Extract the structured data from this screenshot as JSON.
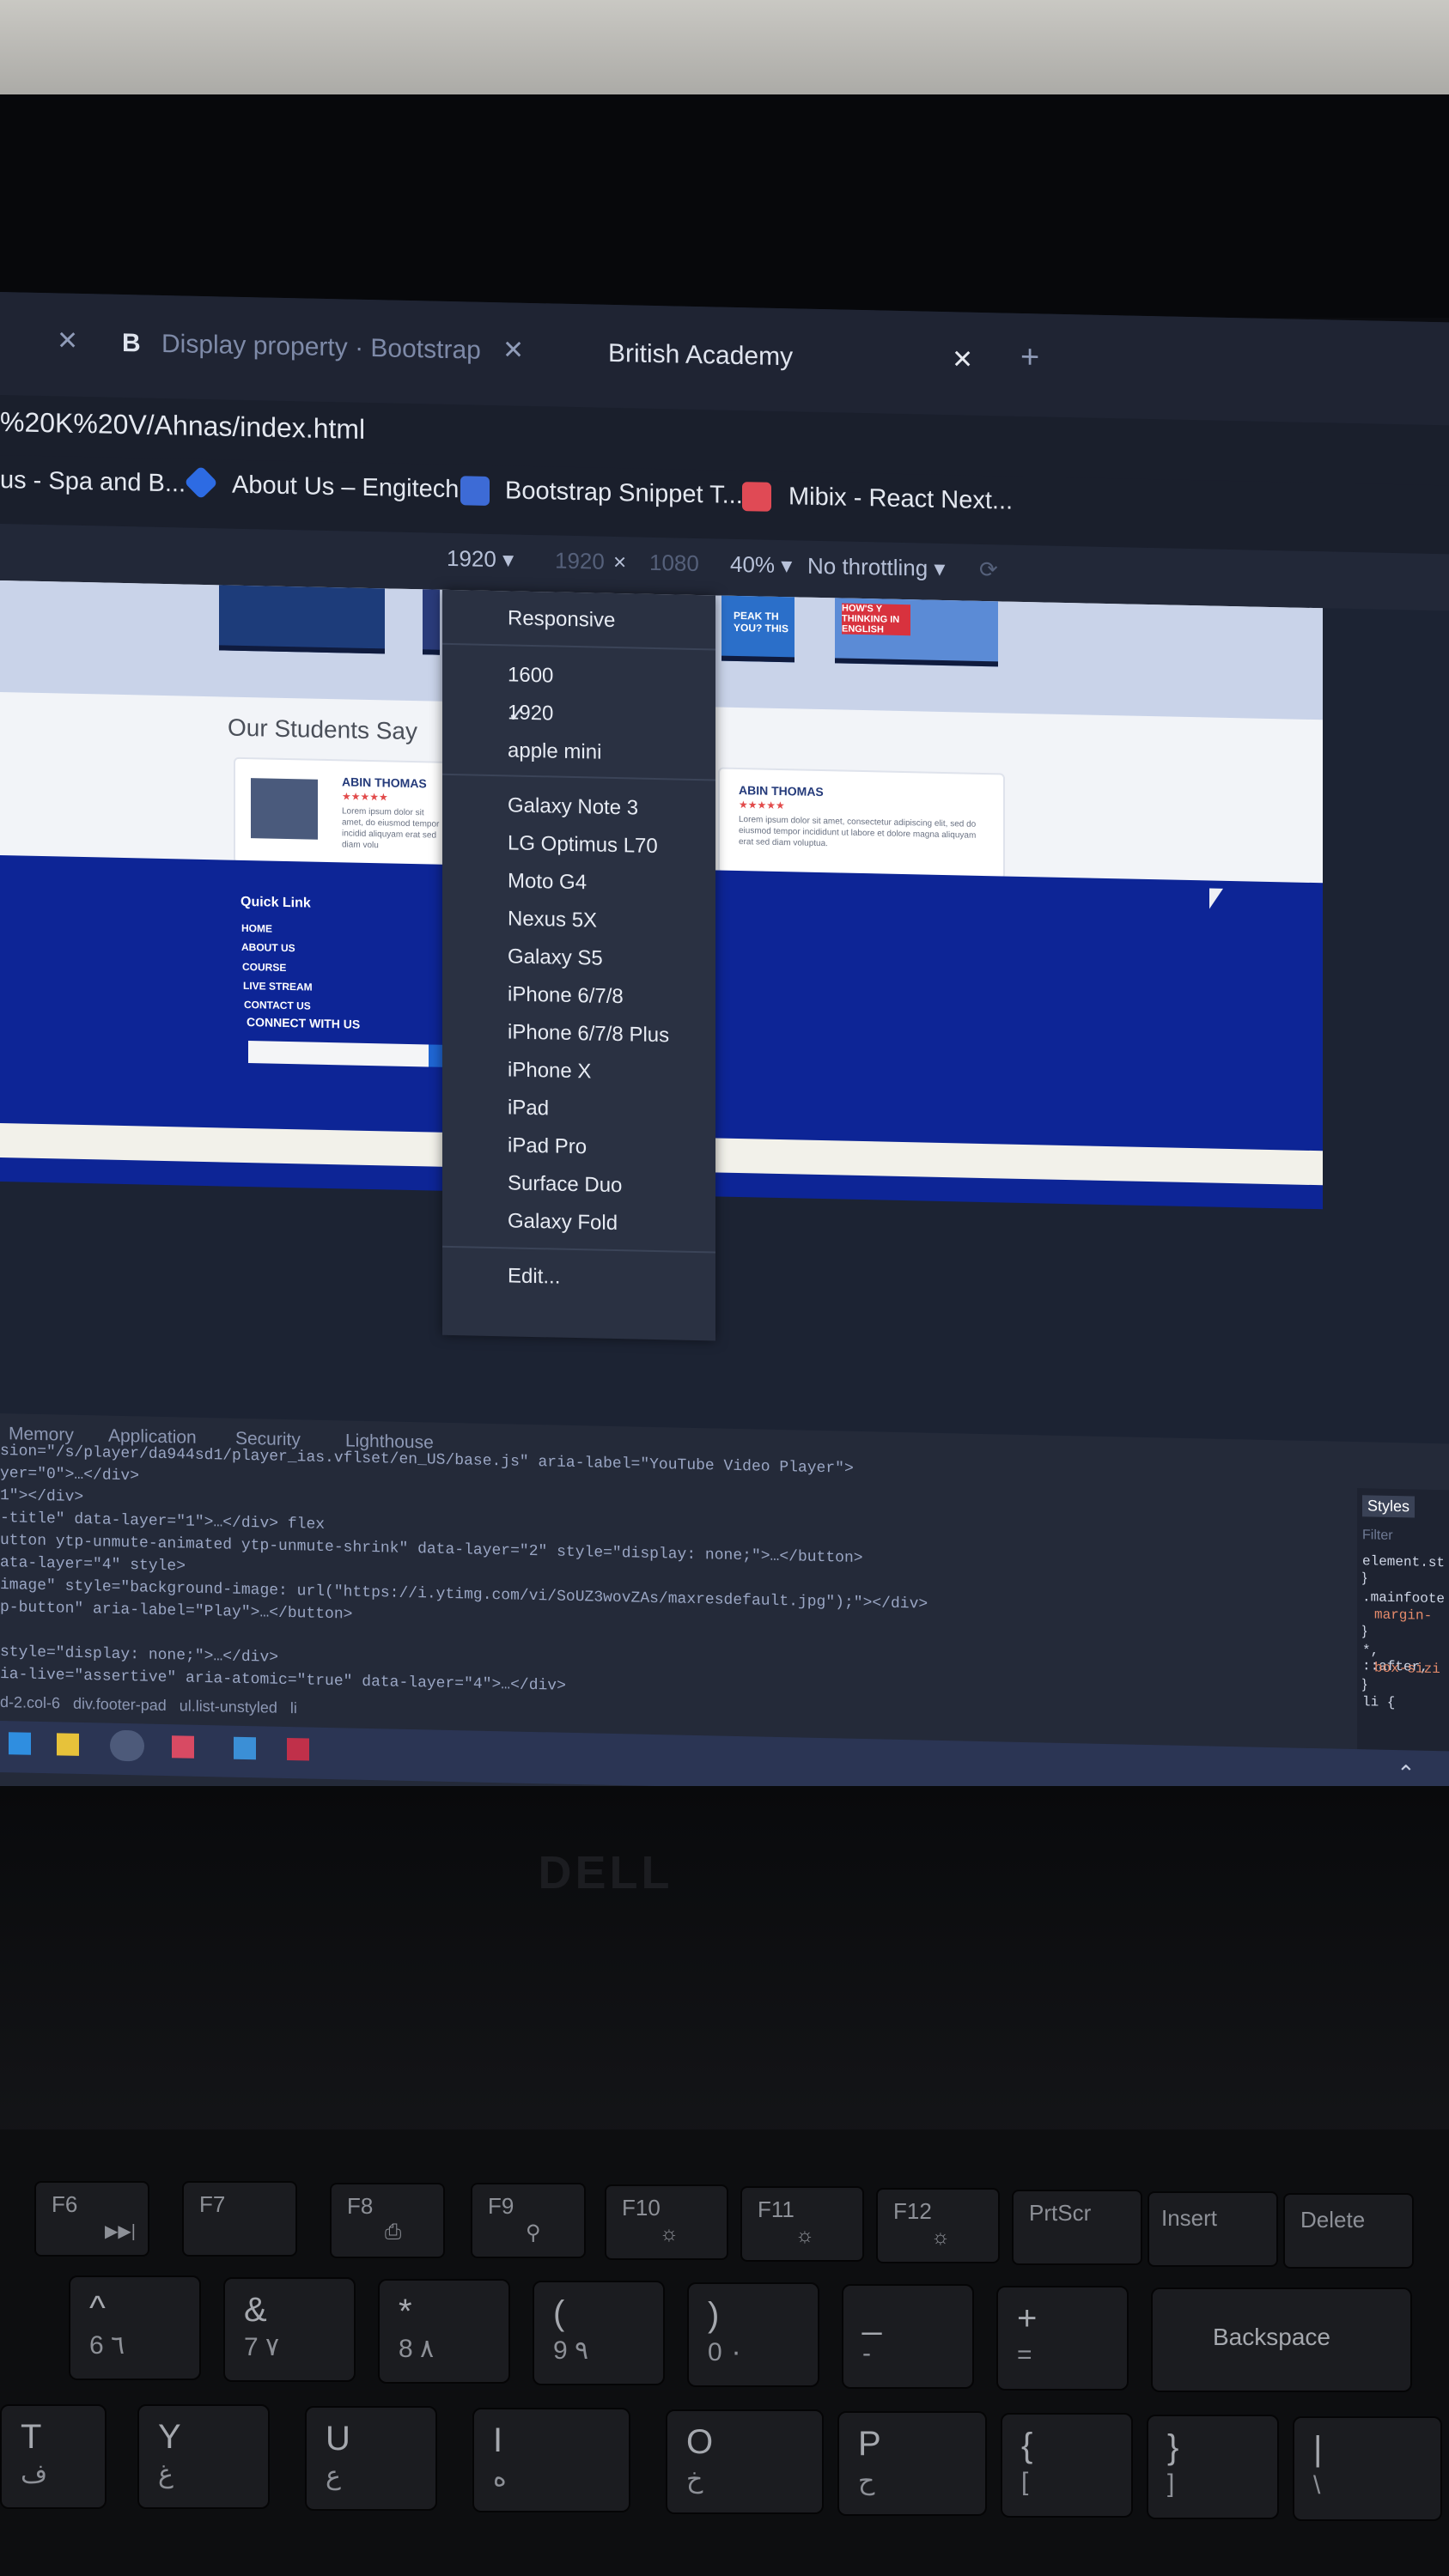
{
  "browser": {
    "tabs": [
      {
        "label": "Display property · Bootstrap",
        "favicon": "B"
      },
      {
        "label": "British Academy"
      }
    ],
    "address": "%20K%20V/Ahnas/index.html",
    "bookmarks": [
      {
        "label": "us - Spa and B..."
      },
      {
        "label": "About Us – Engitech"
      },
      {
        "label": "Bootstrap Snippet T..."
      },
      {
        "label": "Mibix - React Next..."
      }
    ]
  },
  "device_toolbar": {
    "selected": "1920",
    "width": "1920",
    "times": "×",
    "height": "1080",
    "zoom": "40%",
    "throttling": "No throttling"
  },
  "device_menu": {
    "items": [
      {
        "label": "Responsive"
      },
      {
        "label": "1600"
      },
      {
        "label": "1920",
        "checked": true
      },
      {
        "label": "apple mini"
      },
      {
        "label": "Galaxy Note 3"
      },
      {
        "label": "LG Optimus L70"
      },
      {
        "label": "Moto G4"
      },
      {
        "label": "Nexus 5X"
      },
      {
        "label": "Galaxy S5"
      },
      {
        "label": "iPhone 6/7/8"
      },
      {
        "label": "iPhone 6/7/8 Plus"
      },
      {
        "label": "iPhone X"
      },
      {
        "label": "iPad"
      },
      {
        "label": "iPad Pro"
      },
      {
        "label": "Surface Duo"
      },
      {
        "label": "Galaxy Fold"
      },
      {
        "label": "Edit..."
      }
    ]
  },
  "page": {
    "students_heading": "Our Students Say",
    "cards": [
      {
        "name": "ABIN THOMAS",
        "stars": "★★★★★",
        "text": "Lorem ipsum dolor sit amet, do eiusmod tempor incidid aliquyam erat sed diam volu"
      },
      {
        "name": "ABIN THOMAS",
        "stars": "★★★★★",
        "text": "Lorem ipsum dolor sit amet, consectetur adipiscing elit, sed do eiusmod tempor incididunt ut labore et dolore magna aliquyam erat sed diam voluptua."
      }
    ],
    "thumbs": [
      {
        "label": "PEAK TH YOU? THIS"
      },
      {
        "label": "HOW'S Y THINKING IN ENGLISH"
      }
    ],
    "footer": {
      "quick_link": "Quick Link",
      "links": [
        "HOME",
        "ABOUT US",
        "COURSE",
        "LIVE STREAM",
        "CONTACT US"
      ],
      "connect": "CONNECT WITH US"
    }
  },
  "devtools": {
    "tabs": [
      "Memory",
      "Application",
      "Security",
      "Lighthouse"
    ],
    "code_lines": [
      "sion=\"/s/player/da944sd1/player_ias.vflset/en_US/base.js\" aria-label=\"YouTube Video Player\">",
      "yer=\"0\">…</div>",
      "1\"></div>",
      "-title\" data-layer=\"1\">…</div> flex",
      "utton ytp-unmute-animated ytp-unmute-shrink\" data-layer=\"2\" style=\"display: none;\">…</button>",
      "ata-layer=\"4\" style>",
      "image\" style=\"background-image: url(\"https://i.ytimg.com/vi/SoUZ3wovZAs/maxresdefault.jpg\");\"></div>",
      "p-button\" aria-label=\"Play\">…</button>",
      "",
      "style=\"display: none;\">…</div>",
      "ia-live=\"assertive\" aria-atomic=\"true\" data-layer=\"4\">…</div>"
    ],
    "breadcrumbs": [
      "d-2.col-6",
      "div.footer-pad",
      "ul.list-unstyled",
      "li"
    ],
    "styles_tab": "Styles",
    "filter_placeholder": "Filter",
    "styles_lines": [
      "element.st",
      "}",
      ".mainfoote",
      "margin-",
      "}",
      "*, ::after,",
      "box-sizi",
      "}",
      "li {"
    ]
  },
  "laptop": {
    "brand": "DELL",
    "function_keys": [
      {
        "label": "F6",
        "sub": "▶▶|"
      },
      {
        "label": "F7",
        "sub": ""
      },
      {
        "label": "F8",
        "sub": "⎙"
      },
      {
        "label": "F9",
        "sub": "⚲"
      },
      {
        "label": "F10",
        "sub": "☼"
      },
      {
        "label": "F11",
        "sub": "☼"
      },
      {
        "label": "F12",
        "sub": "☼"
      },
      {
        "label": "PrtScr",
        "sub": ""
      },
      {
        "label": "Insert",
        "sub": ""
      },
      {
        "label": "Delete",
        "sub": ""
      }
    ],
    "number_keys": [
      {
        "top": "^",
        "bottom": "6  ٦"
      },
      {
        "top": "&",
        "bottom": "7  ٧"
      },
      {
        "top": "*",
        "bottom": "8  ٨"
      },
      {
        "top": "(",
        "bottom": "9  ٩"
      },
      {
        "top": ")",
        "bottom": "0  ٠"
      },
      {
        "top": "_",
        "bottom": "-"
      },
      {
        "top": "+",
        "bottom": "="
      },
      {
        "top": "",
        "bottom": "Backspace"
      }
    ],
    "letter_keys": [
      {
        "top": "T",
        "bottom": "ف"
      },
      {
        "top": "Y",
        "bottom": "غ"
      },
      {
        "top": "U",
        "bottom": "ع"
      },
      {
        "top": "I",
        "bottom": "ه"
      },
      {
        "top": "O",
        "bottom": "خ"
      },
      {
        "top": "P",
        "bottom": "ح"
      },
      {
        "top": "{",
        "bottom": "["
      },
      {
        "top": "}",
        "bottom": "]"
      },
      {
        "top": "|",
        "bottom": "\\"
      }
    ]
  }
}
